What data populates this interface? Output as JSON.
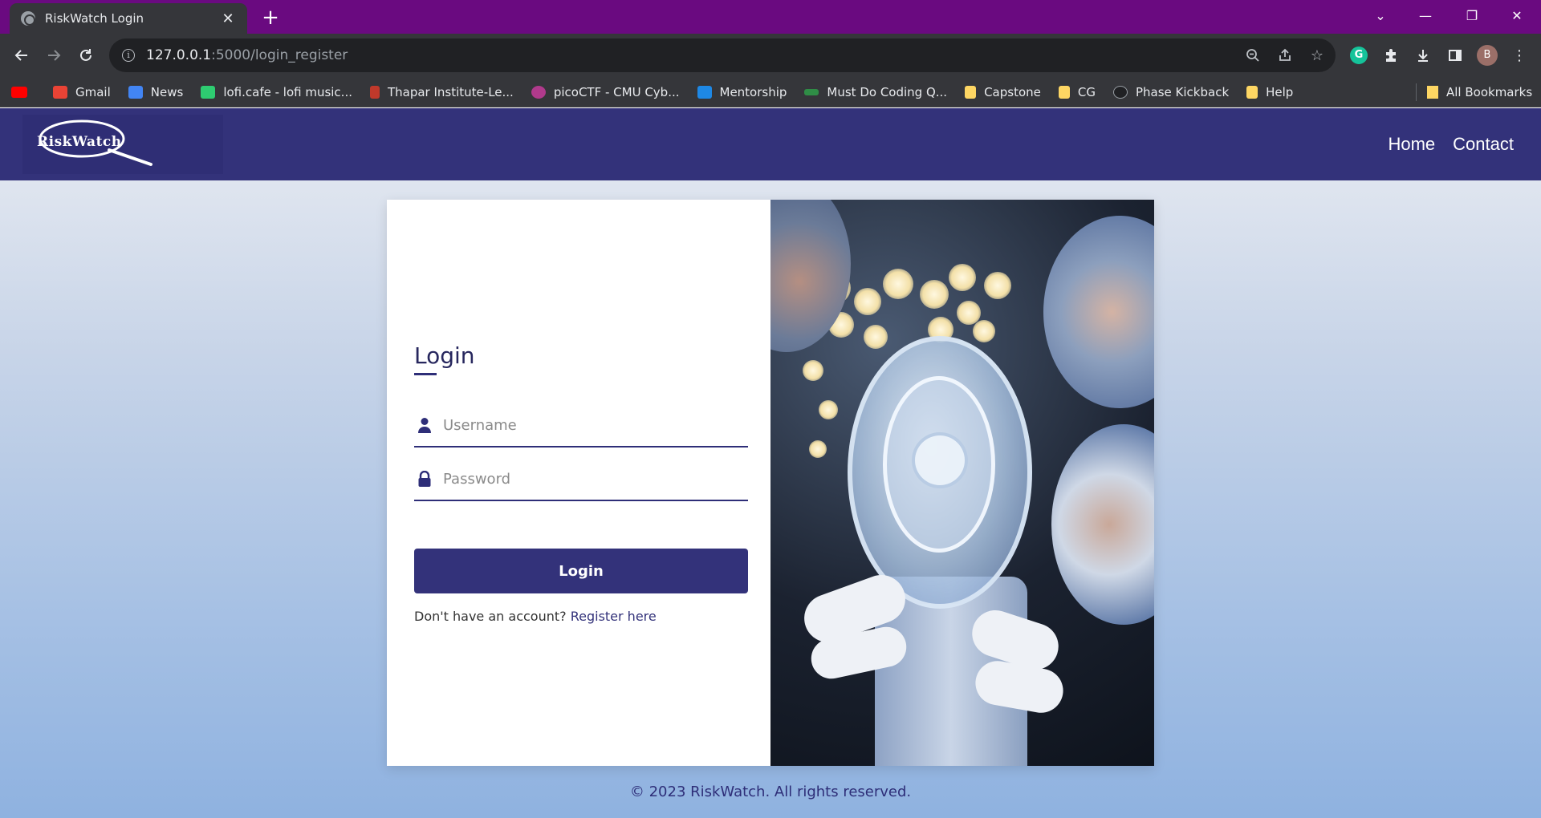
{
  "browser": {
    "tab_title": "RiskWatch Login",
    "tab_close": "✕",
    "new_tab": "+",
    "url_host": "127.0.0.1",
    "url_path": ":5000/login_register",
    "avatar_letter": "B",
    "window_controls": {
      "minimize": "—",
      "restore": "❐",
      "close": "✕",
      "tab_search": "⌄"
    },
    "bookmarks": [
      {
        "label": "Gmail",
        "color": "#ea4335"
      },
      {
        "label": "News",
        "color": "#4285f4"
      },
      {
        "label": "lofi.cafe - lofi music...",
        "color": "#2ecc71"
      },
      {
        "label": "Thapar Institute-Le...",
        "color": "#c0392b"
      },
      {
        "label": "picoCTF - CMU Cyb...",
        "color": "#b03a8c"
      },
      {
        "label": "Mentorship",
        "color": "#1e88e5"
      },
      {
        "label": "Must Do Coding Q...",
        "color": "#2f8d46"
      },
      {
        "label": "Capstone",
        "color": "#fdd663"
      },
      {
        "label": "CG",
        "color": "#fdd663"
      },
      {
        "label": "Phase Kickback",
        "color": "#202124"
      },
      {
        "label": "Help",
        "color": "#fdd663"
      }
    ],
    "all_bookmarks": "All Bookmarks"
  },
  "site": {
    "logo_text": "RiskWatch",
    "nav": {
      "home": "Home",
      "contact": "Contact"
    }
  },
  "login": {
    "title": "Login",
    "username_placeholder": "Username",
    "password_placeholder": "Password",
    "button": "Login",
    "register_prompt": "Don't have an account?",
    "register_link": "Register here"
  },
  "footer": "© 2023 RiskWatch. All rights reserved.",
  "colors": {
    "brand": "#33327a",
    "tab_strip": "#6a0a80",
    "chrome": "#35363a"
  }
}
